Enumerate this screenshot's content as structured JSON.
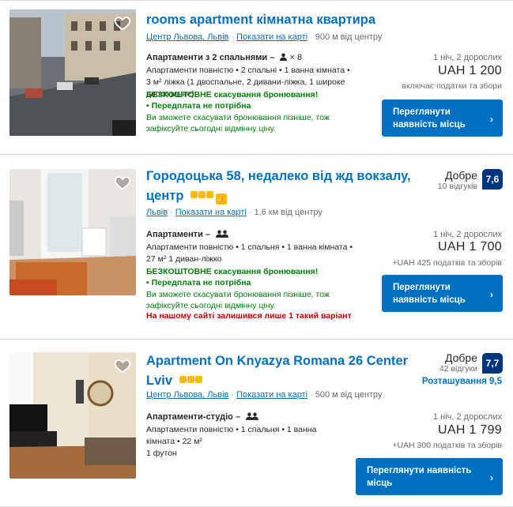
{
  "listings": [
    {
      "title": "rooms apartment кімнатна квартира",
      "location_link": "Центр Львова, Львів",
      "map_link": "Показати на карті",
      "distance": "900 м від центру",
      "room_type": "Апартаменти з 2 спальнями",
      "guests_text": "× 8",
      "description": "Апартаменти повністю • 2 спальні • 1 ванна кімната • 3 м² ліжка (1 двоспальне, 2 дивани-ліжка, 1 широке двоспальне)",
      "free_cancel": "БЕЗКОШТОВНЕ скасування бронювання!",
      "no_prepay": "• Передплата не потрібна",
      "cancel_note": "Ви зможете скасувати бронювання пізніше, тож зафіксуйте сьогодні відмінну ціну.",
      "nights": "1 ніч, 2 дорослих",
      "price": "UAH 1 200",
      "taxes": "включає податки та збори",
      "button": "Переглянути наявність місць"
    },
    {
      "title_line1": "Городоцька 58, недалеко від жд вокзалу,",
      "title_line2": "центр",
      "stars": 3,
      "location_link": "Львів",
      "map_link": "Показати на карті",
      "distance": "1,6 км від центру",
      "room_type": "Апартаменти",
      "description": "Апартаменти повністю • 1 спальня • 1 ванна кімната • 27 м² 1 диван-ліжко",
      "free_cancel": "БЕЗКОШТОВНЕ скасування бронювання!",
      "no_prepay": "• Передплата не потрібна",
      "cancel_note": "Ви зможете скасувати бронювання пізніше, тож зафіксуйте сьогодні відмінну ціну.",
      "scarcity": "На нашому сайті залишився лише 1 такий варіант",
      "review_word": "Добре",
      "review_count": "10 відгуків",
      "score": "7,6",
      "nights": "1 ніч, 2 дорослих",
      "price": "UAH 1 700",
      "taxes": "+UAH 425 податків та зборів",
      "button": "Переглянути наявність місць"
    },
    {
      "title_line1": "Apartment On Knyazya Romana 26 Center",
      "title_line2": "Lviv",
      "stars": 3,
      "location_link": "Центр Львова, Львів",
      "map_link": "Показати на карті",
      "distance": "500 м від центру",
      "room_type": "Апартаменти-студіо",
      "description": "Апартаменти повністю • 1 спальня • 1 ванна кімната • 22 м²",
      "description2": "1 футон",
      "review_word": "Добре",
      "review_count": "42 відгуки",
      "score": "7,7",
      "location_score": "Розташування 9,5",
      "nights": "1 ніч, 2 дорослих",
      "price": "UAH 1 799",
      "taxes": "+UAH 300 податків та зборів",
      "button": "Переглянути наявність місць"
    }
  ],
  "colors": {
    "link": "#0071c2",
    "green": "#008009",
    "score_bg": "#003580",
    "star": "#febb02",
    "alert": "#cc0000"
  },
  "icons": [
    "heart-icon",
    "person-icon",
    "chevron-right-icon",
    "star-icon",
    "thumbs-up-icon"
  ]
}
